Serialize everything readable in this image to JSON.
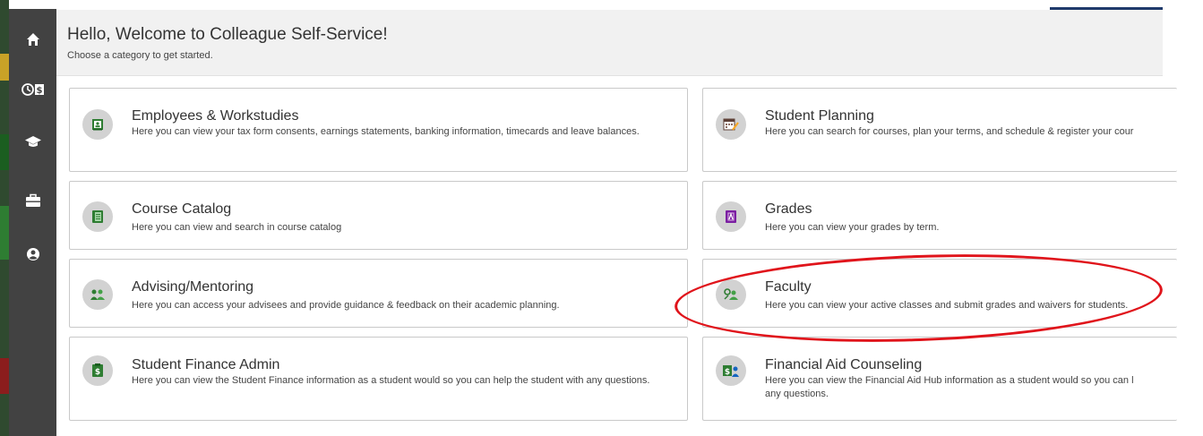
{
  "header": {
    "title": "Hello, Welcome to Colleague Self-Service!",
    "subtitle": "Choose a category to get started."
  },
  "sidebar": {
    "items": [
      {
        "icon": "home-icon"
      },
      {
        "icon": "finance-icon"
      },
      {
        "icon": "graduation-cap-icon"
      },
      {
        "icon": "briefcase-icon"
      },
      {
        "icon": "user-circle-icon"
      }
    ]
  },
  "cards": {
    "employees": {
      "title": "Employees & Workstudies",
      "description": "Here you can view your tax form consents, earnings statements, banking information, timecards and leave balances."
    },
    "student_planning": {
      "title": "Student Planning",
      "description": "Here you can search for courses, plan your terms, and schedule & register your cour"
    },
    "course_catalog": {
      "title": "Course Catalog",
      "description": "Here you can view and search in course catalog"
    },
    "grades": {
      "title": "Grades",
      "description": "Here you can view your grades by term."
    },
    "advising": {
      "title": "Advising/Mentoring",
      "description": "Here you can access your advisees and provide guidance & feedback on their academic planning."
    },
    "faculty": {
      "title": "Faculty",
      "description": "Here you can view your active classes and submit grades and waivers for students."
    },
    "student_finance_admin": {
      "title": "Student Finance Admin",
      "description": "Here you can view the Student Finance information as a student would so you can help the student with any questions."
    },
    "financial_aid_counseling": {
      "title": "Financial Aid Counseling",
      "description": "Here you can view the Financial Aid Hub information as a student would so you can l",
      "description_line2": "any questions."
    }
  },
  "colors": {
    "sidebar": "#424242",
    "header_bg": "#f1f1f1",
    "annotation": "#e0141b",
    "icon_green": "#2e7d32",
    "icon_purple": "#7b1fa2"
  }
}
